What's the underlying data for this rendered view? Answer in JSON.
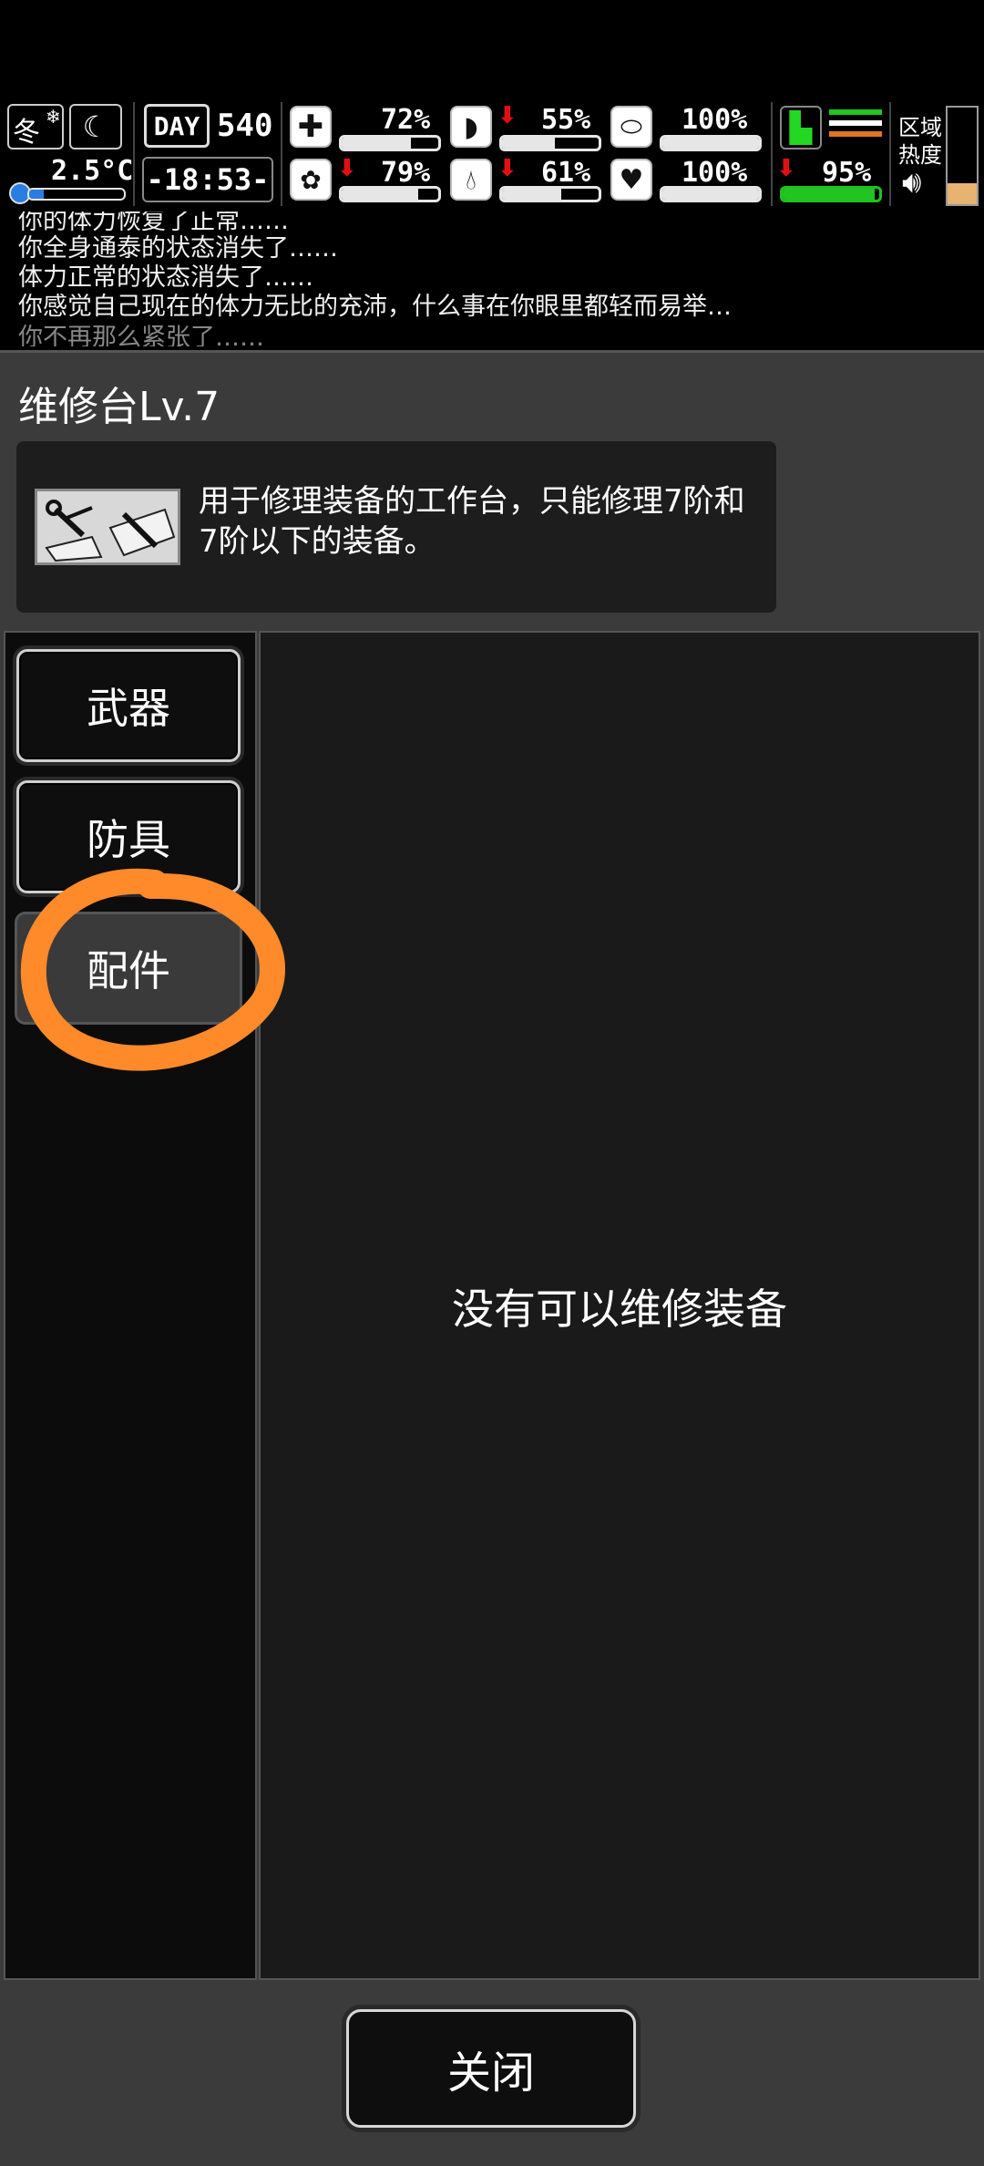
{
  "hud": {
    "season": "冬",
    "temperature": "2.5°C",
    "temperature_level": 0.15,
    "day_label": "DAY",
    "day_number": "540",
    "time": "-18:53-",
    "health": {
      "value": "72%",
      "level": 0.72
    },
    "hunger": {
      "value": "55%",
      "level": 0.55,
      "trend": "down"
    },
    "stamina": {
      "value": "100%",
      "level": 1.0
    },
    "sanity": {
      "value": "79%",
      "level": 0.79,
      "trend": "down"
    },
    "thirst": {
      "value": "61%",
      "level": 0.61,
      "trend": "down"
    },
    "mood": {
      "value": "100%",
      "level": 1.0
    },
    "weight": {
      "value": "95%",
      "level": 0.95,
      "trend": "down"
    },
    "zone_heat_label_1": "区域",
    "zone_heat_label_2": "热度",
    "colors": {
      "weight_bar": "#21c421",
      "alert_arrow": "#e01010",
      "boot_icon": "#22d822"
    }
  },
  "log": {
    "lines": [
      "你的体力恢复了正常……",
      "你全身通泰的状态消失了……",
      "体力正常的状态消失了……",
      "你感觉自己现在的体力无比的充沛，什么事在你眼里都轻而易举…",
      "你不再那么紧张了……"
    ]
  },
  "panel": {
    "title": "维修台Lv.7",
    "description": "用于修理装备的工作台，只能修理7阶和7阶以下的装备。",
    "tabs": [
      {
        "label": "武器",
        "active": false
      },
      {
        "label": "防具",
        "active": false
      },
      {
        "label": "配件",
        "active": true
      }
    ],
    "empty_message": "没有可以维修装备",
    "close_label": "关闭",
    "annotation_color": "#ff8a2a"
  }
}
